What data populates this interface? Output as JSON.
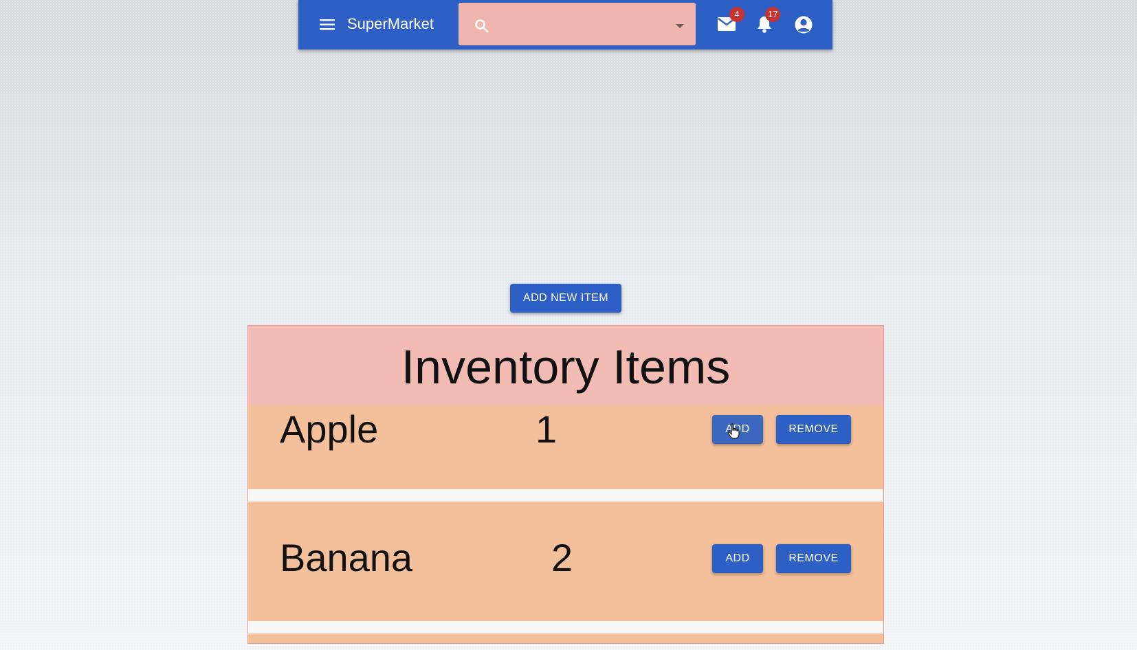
{
  "appbar": {
    "title": "SuperMarket",
    "search": {
      "placeholder": "",
      "value": ""
    },
    "mail_badge": "4",
    "notifications_badge": "17"
  },
  "actions": {
    "add_new_label": "ADD NEW ITEM"
  },
  "inventory": {
    "title": "Inventory Items",
    "items": [
      {
        "name": "Apple",
        "quantity": "1",
        "add_label": "ADD",
        "remove_label": "REMOVE"
      },
      {
        "name": "Banana",
        "quantity": "2",
        "add_label": "ADD",
        "remove_label": "REMOVE"
      }
    ]
  },
  "colors": {
    "primary": "#2d5fc4",
    "search_bg": "#f0b6ae",
    "header_bg": "#f2bcb5",
    "row_bg": "#f4c09c",
    "badge": "#c8322f"
  },
  "icons": [
    "menu-icon",
    "search-icon",
    "chevron-down-icon",
    "mail-icon",
    "bell-icon",
    "account-circle-icon",
    "hand-pointer-icon"
  ]
}
